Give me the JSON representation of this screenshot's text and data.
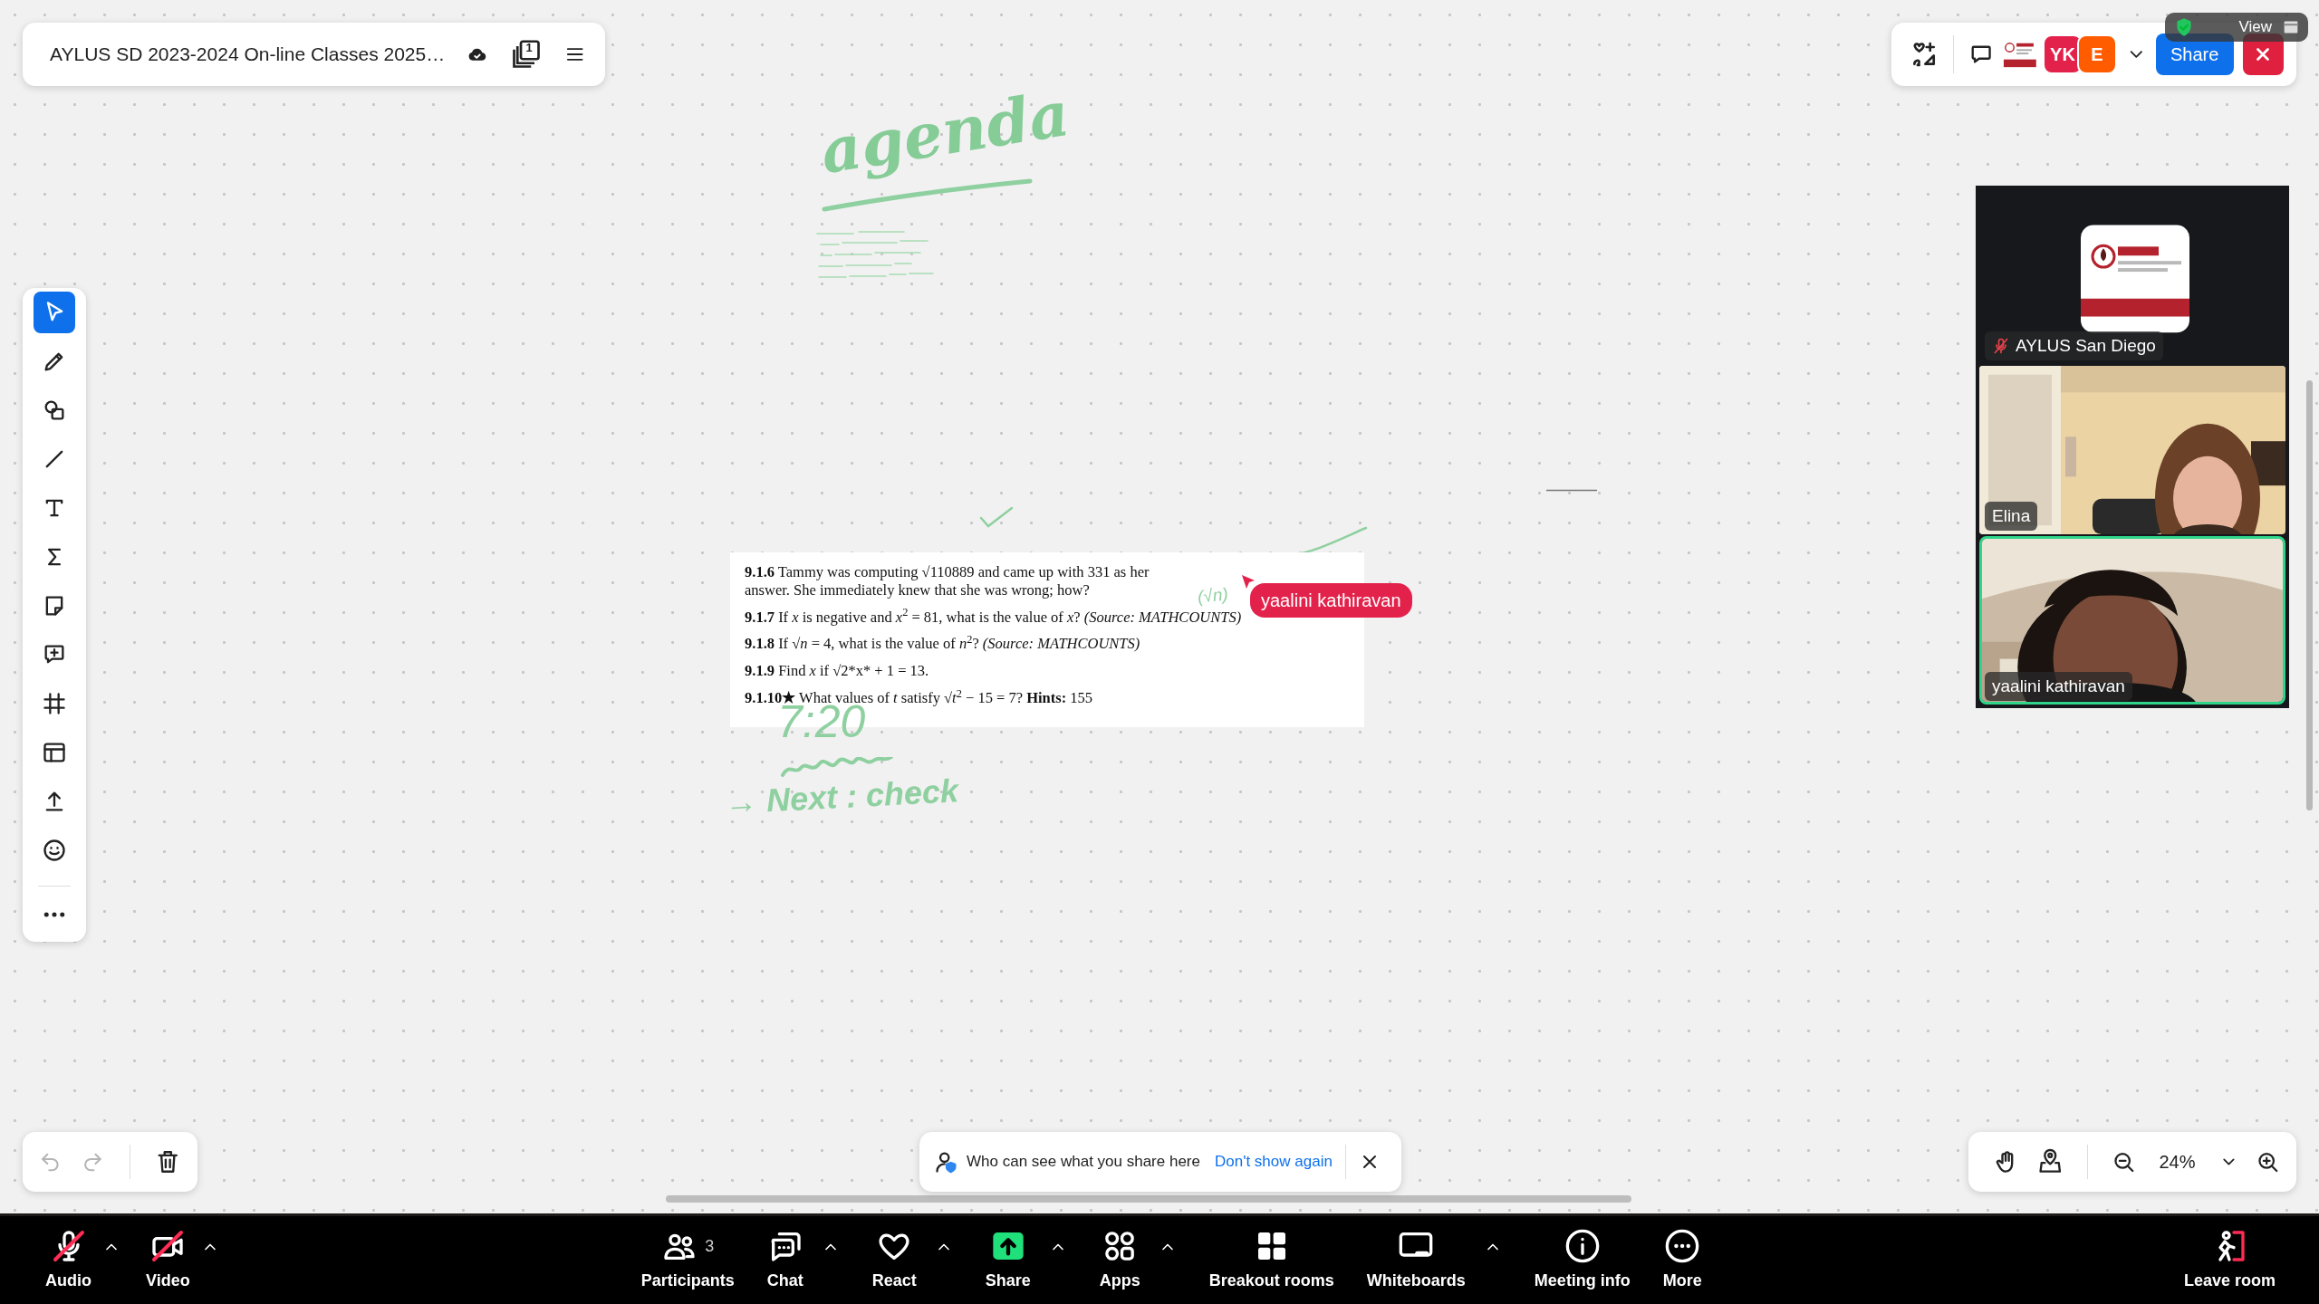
{
  "board_header": {
    "title": "AYLUS SD 2023-2024 On-line Classes 2025…",
    "page_count": "1"
  },
  "top_bar": {
    "avatars": [
      {
        "initials": "YK",
        "color": "#e3224c"
      },
      {
        "initials": "E",
        "color": "#ff5c00"
      }
    ],
    "share_button": "Share",
    "view_tooltip": "View"
  },
  "tools": [
    {
      "kind": "select",
      "selected": true
    },
    {
      "kind": "pen",
      "selected": false
    },
    {
      "kind": "shapes",
      "selected": false
    },
    {
      "kind": "line",
      "selected": false
    },
    {
      "kind": "text",
      "selected": false
    },
    {
      "kind": "formula",
      "selected": false
    },
    {
      "kind": "sticky",
      "selected": false
    },
    {
      "kind": "comment",
      "selected": false
    },
    {
      "kind": "frame",
      "selected": false
    },
    {
      "kind": "template",
      "selected": false
    },
    {
      "kind": "upload",
      "selected": false
    },
    {
      "kind": "emoji",
      "selected": false
    }
  ],
  "ink": [
    {
      "kind": "heading",
      "text": "agenda"
    },
    {
      "kind": "note",
      "text": "(√n)"
    },
    {
      "kind": "note",
      "text": "7:20"
    },
    {
      "kind": "note",
      "text": "→ Next : check"
    }
  ],
  "document": {
    "problems": [
      "**9.1.6** Tammy was computing √110889 and came up with 331 as her answer. She immediately knew that she was wrong; how?",
      "**9.1.7** If *x* is negative and *x*$^{2}$ = 81, what is the value of *x*? *(Source: MATHCOUNTS)*",
      "**9.1.8** If √*n* = 4, what is the value of *n*$^{2}$? *(Source: MATHCOUNTS)*",
      "**9.1.9** Find *x* if √2*x* + 1 = 13.",
      "**9.1.10★** What values of *t* satisfy √*t*$^{2}$ − 15 = 7? **Hints:** 155"
    ]
  },
  "cursor": {
    "name": "yaalini kathiravan",
    "color": "#e3224c"
  },
  "video_tiles": [
    {
      "kind": "logo",
      "name": "AYLUS San Diego",
      "muted": true,
      "speaking": false
    },
    {
      "kind": "camera",
      "name": "Elina",
      "muted": false,
      "speaking": false
    },
    {
      "kind": "camera",
      "name": "yaalini kathiravan",
      "muted": false,
      "speaking": true
    }
  ],
  "history_controls": [
    {
      "kind": "undo",
      "disabled": true
    },
    {
      "kind": "redo",
      "disabled": true
    },
    {
      "kind": "delete",
      "disabled": false
    }
  ],
  "notice": {
    "text": "Who can see what you share here",
    "link": "Don't show again"
  },
  "zoom": {
    "value": "24%"
  },
  "meeting_toolbar": [
    {
      "kind": "audio",
      "label": "Audio",
      "off": true,
      "menu": true
    },
    {
      "kind": "video",
      "label": "Video",
      "off": true,
      "menu": true
    },
    {
      "kind": "participants",
      "label": "Participants",
      "count": "3",
      "off": false,
      "menu": false
    },
    {
      "kind": "chat",
      "label": "Chat",
      "off": false,
      "menu": true
    },
    {
      "kind": "react",
      "label": "React",
      "off": false,
      "menu": true
    },
    {
      "kind": "share",
      "label": "Share",
      "off": false,
      "menu": true
    },
    {
      "kind": "apps",
      "label": "Apps",
      "off": false,
      "menu": true
    },
    {
      "kind": "breakout",
      "label": "Breakout rooms",
      "off": false,
      "menu": false
    },
    {
      "kind": "whiteboards",
      "label": "Whiteboards",
      "off": false,
      "menu": true
    },
    {
      "kind": "info",
      "label": "Meeting info",
      "off": false,
      "menu": false
    },
    {
      "kind": "more",
      "label": "More",
      "off": false,
      "menu": false
    },
    {
      "kind": "leave",
      "label": "Leave room",
      "off": false,
      "menu": false
    }
  ]
}
